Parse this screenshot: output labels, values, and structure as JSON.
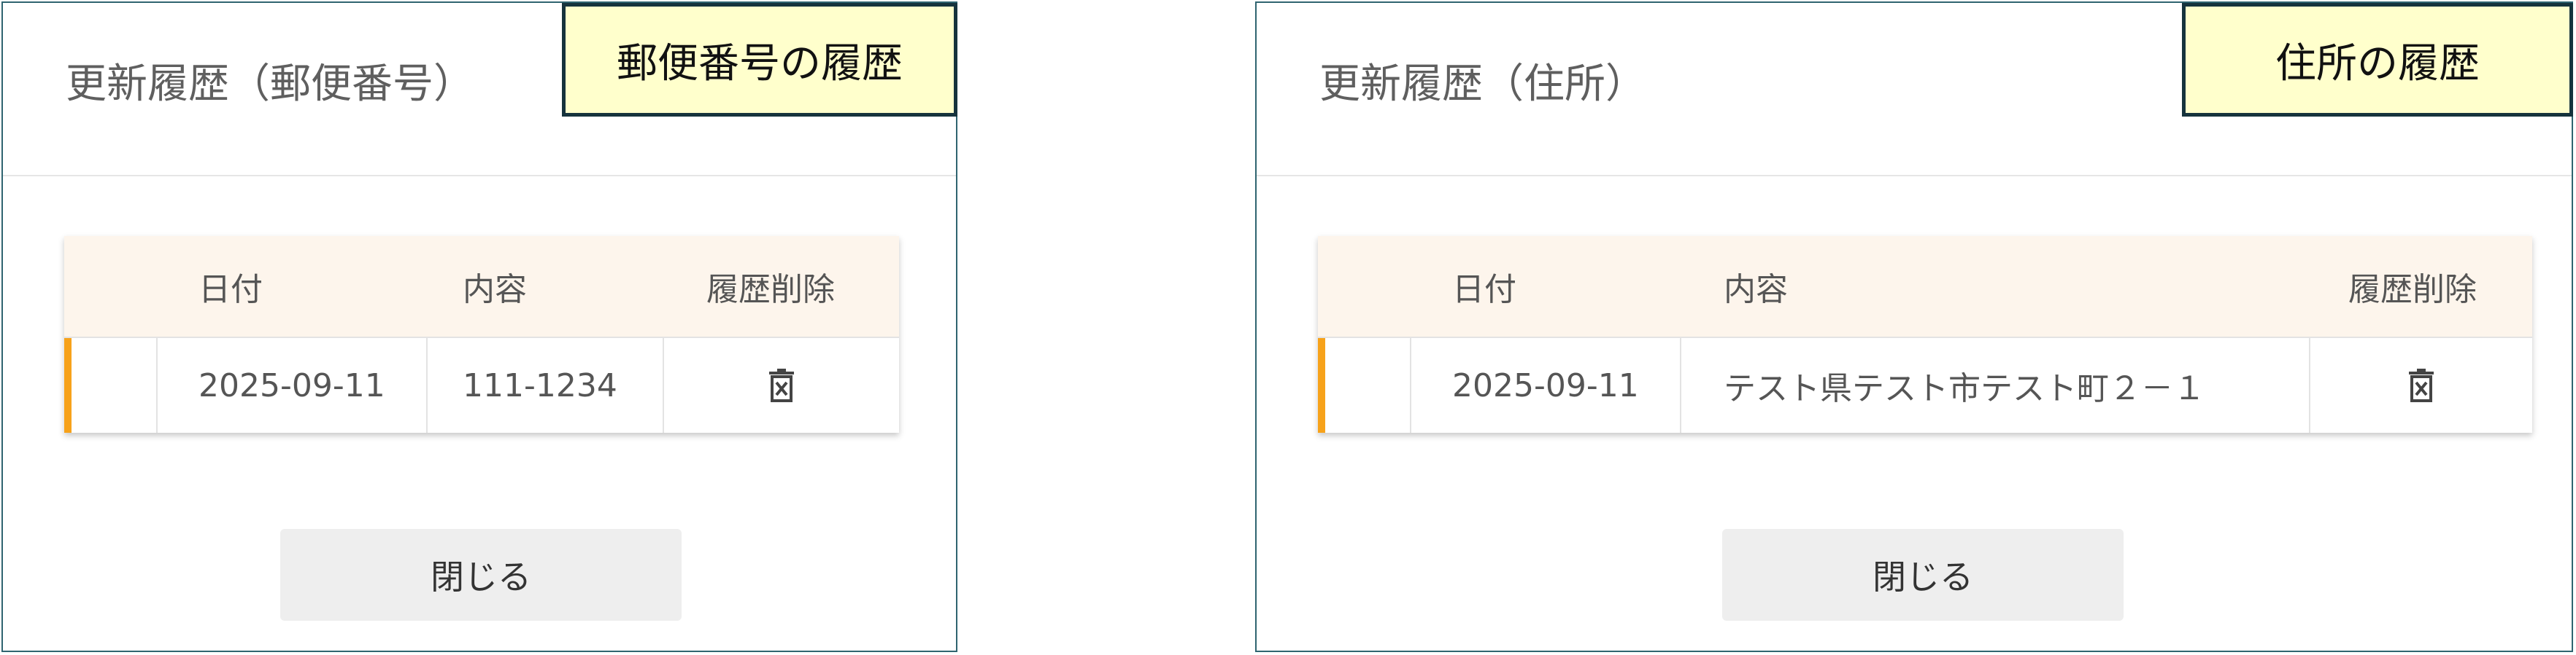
{
  "postal_dialog": {
    "title": "更新履歴（郵便番号）",
    "callout": "郵便番号の履歴",
    "columns": {
      "date": "日付",
      "content": "内容",
      "delete": "履歴削除"
    },
    "rows": [
      {
        "date": "2025-09-11",
        "content": "111-1234"
      }
    ],
    "close_label": "閉じる"
  },
  "address_dialog": {
    "title": "更新履歴（住所）",
    "callout": "住所の履歴",
    "columns": {
      "date": "日付",
      "content": "内容",
      "delete": "履歴削除"
    },
    "rows": [
      {
        "date": "2025-09-11",
        "content": "テスト県テスト市テスト町２－１"
      }
    ],
    "close_label": "閉じる"
  },
  "icons": {
    "delete": "trash-icon"
  },
  "colors": {
    "accent_bar": "#f7a21a",
    "header_bg": "#fdf5ec",
    "callout_bg": "#ffffcc",
    "dialog_border": "#2f6470"
  }
}
